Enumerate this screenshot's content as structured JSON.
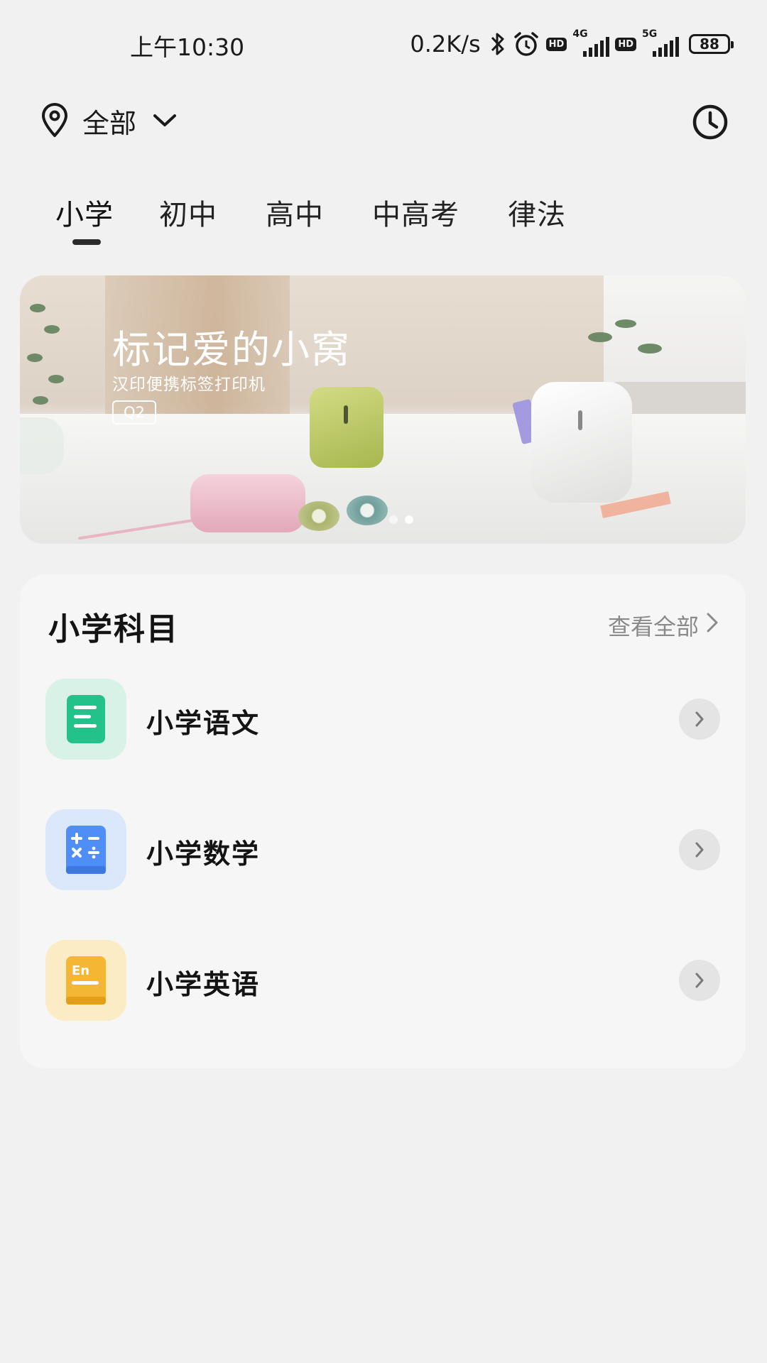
{
  "status_bar": {
    "time": "上午10:30",
    "net_speed": "0.2K/s",
    "hd_label": "HD",
    "sim1_net": "4G",
    "sim2_net": "5G",
    "battery": "88"
  },
  "header": {
    "location": "全部"
  },
  "tabs": [
    {
      "label": "小学",
      "active": true
    },
    {
      "label": "初中",
      "active": false
    },
    {
      "label": "高中",
      "active": false
    },
    {
      "label": "中高考",
      "active": false
    },
    {
      "label": "律法",
      "active": false
    }
  ],
  "banner": {
    "title": "标记爱的小窝",
    "subtitle": "汉印便携标签打印机",
    "tag": "Q2",
    "slide_count": 2,
    "active_slide": 2
  },
  "subjects_card": {
    "title": "小学科目",
    "view_all": "查看全部",
    "items": [
      {
        "label": "小学语文",
        "icon": "document-icon",
        "color": "#22c28a"
      },
      {
        "label": "小学数学",
        "icon": "calculator-icon",
        "color": "#4f8ef7"
      },
      {
        "label": "小学英语",
        "icon": "english-book-icon",
        "color": "#f5b731"
      }
    ]
  }
}
